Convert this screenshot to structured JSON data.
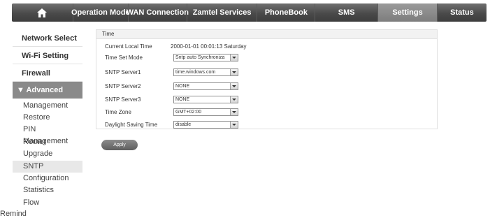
{
  "nav": {
    "items": [
      "Operation Mode",
      "WAN Connection",
      "Zamtel Services",
      "PhoneBook",
      "SMS",
      "Settings",
      "Status"
    ],
    "active": "Settings"
  },
  "sidebar": {
    "main": [
      "Network Select",
      "Wi-Fi Setting",
      "Firewall"
    ],
    "advanced": "▼ Advanced",
    "sub": [
      "Management",
      "Restore",
      "PIN Management",
      "Router",
      "Upgrade",
      "SNTP",
      "Configuration",
      "Statistics",
      "Flow"
    ],
    "active_sub": "SNTP",
    "remind": "Remind"
  },
  "panel": {
    "title": "Time",
    "current_time_label": "Current Local Time",
    "current_time_value": "2000-01-01   00:01:13   Saturday",
    "fields": [
      {
        "label": "Time Set Mode",
        "value": "Sntp auto Synchroniza"
      },
      {
        "label": "SNTP Server1",
        "value": "time.windows.com"
      },
      {
        "label": "SNTP Server2",
        "value": "NONE"
      },
      {
        "label": "SNTP Server3",
        "value": "NONE"
      },
      {
        "label": "Time Zone",
        "value": "GMT+02:00"
      },
      {
        "label": "Daylight Saving Time",
        "value": "disable"
      }
    ]
  },
  "apply_label": "Apply"
}
